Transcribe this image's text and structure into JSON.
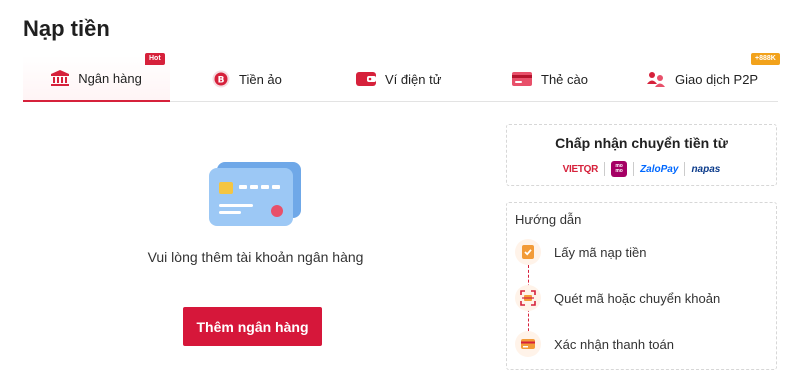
{
  "page_title": "Nạp tiền",
  "tabs": [
    {
      "label": "Ngân hàng",
      "icon": "bank-icon",
      "active": true,
      "badge": "Hot"
    },
    {
      "label": "Tiền ảo",
      "icon": "bitcoin-icon"
    },
    {
      "label": "Ví điện tử",
      "icon": "wallet-icon"
    },
    {
      "label": "Thẻ cào",
      "icon": "scratch-card-icon"
    },
    {
      "label": "Giao dịch P2P",
      "icon": "p2p-icon",
      "badge": "+888K"
    }
  ],
  "main": {
    "empty_message": "Vui lòng thêm tài khoản ngân hàng",
    "add_bank_button": "Thêm ngân hàng"
  },
  "accept": {
    "title": "Chấp nhận chuyển tiền từ",
    "logos": {
      "vietqr": "VIETQR",
      "momo": "mo mo",
      "zalopay": "ZaloPay",
      "napas": "napas"
    }
  },
  "guide": {
    "title": "Hướng dẫn",
    "steps": [
      {
        "label": "Lấy mã nạp tiền",
        "icon": "checklist-icon"
      },
      {
        "label": "Quét mã hoặc chuyển khoản",
        "icon": "scan-qr-icon"
      },
      {
        "label": "Xác nhận thanh toán",
        "icon": "payment-card-icon"
      }
    ]
  },
  "colors": {
    "accent": "#d6213b",
    "bonus": "#f2a21b"
  }
}
